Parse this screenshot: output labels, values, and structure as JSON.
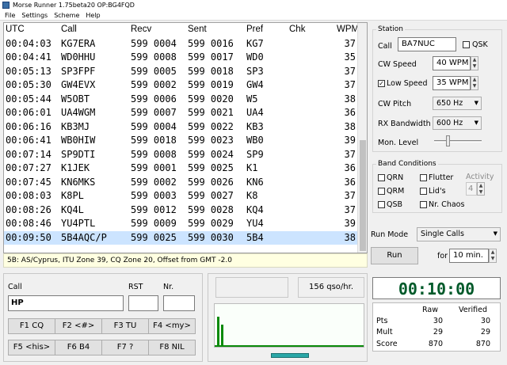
{
  "titlebar": {
    "title": "Morse Runner 1.75beta20   OP:BG4FQD",
    "icon": "morse-runner-app-icon"
  },
  "menu": [
    "File",
    "Settings",
    "Scheme",
    "Help"
  ],
  "log": {
    "headers": {
      "utc": "UTC",
      "call": "Call",
      "recv": "Recv",
      "sent": "Sent",
      "pref": "Pref",
      "chk": "Chk",
      "wpm": "WPM"
    },
    "rows": [
      {
        "utc": "00:04:03",
        "call": "KG7ERA",
        "recv": "599 0004",
        "sent": "599 0016",
        "pref": "KG7",
        "chk": "",
        "wpm": "37"
      },
      {
        "utc": "00:04:41",
        "call": "WD0HHU",
        "recv": "599 0008",
        "sent": "599 0017",
        "pref": "WD0",
        "chk": "",
        "wpm": "35"
      },
      {
        "utc": "00:05:13",
        "call": "SP3FPF",
        "recv": "599 0005",
        "sent": "599 0018",
        "pref": "SP3",
        "chk": "",
        "wpm": "37"
      },
      {
        "utc": "00:05:30",
        "call": "GW4EVX",
        "recv": "599 0002",
        "sent": "599 0019",
        "pref": "GW4",
        "chk": "",
        "wpm": "37"
      },
      {
        "utc": "00:05:44",
        "call": "W5OBT",
        "recv": "599 0006",
        "sent": "599 0020",
        "pref": "W5",
        "chk": "",
        "wpm": "38"
      },
      {
        "utc": "00:06:01",
        "call": "UA4WGM",
        "recv": "599 0007",
        "sent": "599 0021",
        "pref": "UA4",
        "chk": "",
        "wpm": "36"
      },
      {
        "utc": "00:06:16",
        "call": "KB3MJ",
        "recv": "599 0004",
        "sent": "599 0022",
        "pref": "KB3",
        "chk": "",
        "wpm": "38"
      },
      {
        "utc": "00:06:41",
        "call": "WB0HIW",
        "recv": "599 0018",
        "sent": "599 0023",
        "pref": "WB0",
        "chk": "",
        "wpm": "39"
      },
      {
        "utc": "00:07:14",
        "call": "SP9DTI",
        "recv": "599 0008",
        "sent": "599 0024",
        "pref": "SP9",
        "chk": "",
        "wpm": "37"
      },
      {
        "utc": "00:07:27",
        "call": "K1JEK",
        "recv": "599 0001",
        "sent": "599 0025",
        "pref": "K1",
        "chk": "",
        "wpm": "36"
      },
      {
        "utc": "00:07:45",
        "call": "KN6MKS",
        "recv": "599 0002",
        "sent": "599 0026",
        "pref": "KN6",
        "chk": "",
        "wpm": "36"
      },
      {
        "utc": "00:08:03",
        "call": "K8PL",
        "recv": "599 0003",
        "sent": "599 0027",
        "pref": "K8",
        "chk": "",
        "wpm": "37"
      },
      {
        "utc": "00:08:26",
        "call": "KQ4L",
        "recv": "599 0012",
        "sent": "599 0028",
        "pref": "KQ4",
        "chk": "",
        "wpm": "37"
      },
      {
        "utc": "00:08:46",
        "call": "YU4PTL",
        "recv": "599 0009",
        "sent": "599 0029",
        "pref": "YU4",
        "chk": "",
        "wpm": "39"
      },
      {
        "utc": "00:09:50",
        "call": "5B4AQC/P",
        "recv": "599 0025",
        "sent": "599 0030",
        "pref": "5B4",
        "chk": "",
        "wpm": "38"
      }
    ]
  },
  "status_line": "5B: AS/Cyprus, ITU Zone 39,  CQ Zone 20,  Offset from GMT -2.0",
  "station": {
    "title": "Station",
    "call_label": "Call",
    "call_value": "BA7NUC",
    "qsk_label": "QSK",
    "cw_speed_label": "CW Speed",
    "cw_speed_value": "40 WPM",
    "low_speed_label": "Low Speed",
    "low_speed_value": "35 WPM",
    "cw_pitch_label": "CW Pitch",
    "cw_pitch_value": "650 Hz",
    "rx_bw_label": "RX Bandwidth",
    "rx_bw_value": "600 Hz",
    "mon_level_label": "Mon. Level",
    "mon_level_fraction": 0.3
  },
  "band": {
    "title": "Band Conditions",
    "qrn": "QRN",
    "flutter": "Flutter",
    "activity_label": "Activity",
    "qrm": "QRM",
    "lids": "Lid's",
    "activity_value": "4",
    "qsb": "QSB",
    "chaos": "Nr. Chaos"
  },
  "run": {
    "mode_label": "Run Mode",
    "mode_value": "Single Calls",
    "run_button": "Run",
    "for_label": "for",
    "duration_value": "10 min."
  },
  "entry": {
    "call_label": "Call",
    "rst_label": "RST",
    "nr_label": "Nr.",
    "call_value": "HP",
    "rst_value": "",
    "nr_value": ""
  },
  "fkeys": [
    "F1  CQ",
    "F2  <#>",
    "F3  TU",
    "F4  <my>",
    "F5  <his>",
    "F6  B4",
    "F7  ?",
    "F8  NIL"
  ],
  "rate": "156  qso/hr.",
  "clock": "00:10:00",
  "score": {
    "header_raw": "Raw",
    "header_verified": "Verified",
    "rows": [
      {
        "label": "Pts",
        "raw": "30",
        "verified": "30"
      },
      {
        "label": "Mult",
        "raw": "29",
        "verified": "29"
      },
      {
        "label": "Score",
        "raw": "870",
        "verified": "870"
      }
    ]
  },
  "colors": {
    "clock_text": "#005a2a",
    "bar_green": "#0a8a0a",
    "selection": "#cce4ff",
    "status_bg": "#ffffe1"
  }
}
